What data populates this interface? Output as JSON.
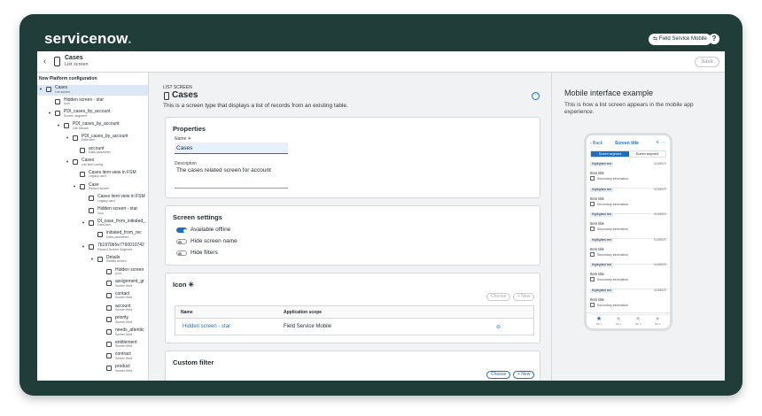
{
  "brand": {
    "name": "servicenow",
    "accent": "#81b5a1",
    "frame_color": "#213d3a",
    "link_color": "#1f6fbf"
  },
  "topbar": {
    "app_badge": "Field Service Mobile",
    "help_icon": "?"
  },
  "header": {
    "back": "‹",
    "title": "Cases",
    "subtitle": "List screen",
    "save": "Save"
  },
  "tree": {
    "heading": "Now Platform configuration",
    "nodes": [
      {
        "label": "Cases",
        "sub": "List screen",
        "caret": "▼",
        "selected": true
      },
      {
        "label": "Hidden screen - star",
        "sub": "Icon",
        "caret": ""
      },
      {
        "label": "PDI_cases_by_account",
        "sub": "Screen segment",
        "caret": "▼"
      },
      {
        "label": "PDI_cases_by_account",
        "sub": "List Stream",
        "caret": "▼"
      },
      {
        "label": "PDI_cases_by_account",
        "sub": "Data item",
        "caret": "▼"
      },
      {
        "label": "account",
        "sub": "Data parameter",
        "caret": ""
      },
      {
        "label": "Cases",
        "sub": "List item config",
        "caret": "▼"
      },
      {
        "label": "Cases item view in FSM",
        "sub": "Legacy card",
        "caret": ""
      },
      {
        "label": "Case",
        "sub": "Record screen",
        "caret": "▼"
      },
      {
        "label": "Cases item view in FSM",
        "sub": "Legacy card",
        "caret": ""
      },
      {
        "label": "Hidden screen - star",
        "sub": "Icon",
        "caret": ""
      },
      {
        "label": "DI_case_from_initiated_",
        "sub": "Data item",
        "caret": "▼"
      },
      {
        "label": "initiated_from_rec",
        "sub": "Data parameter",
        "caret": ""
      },
      {
        "label": "7b1970b5e7760010742",
        "sub": "Record Screen Segment",
        "caret": "▼"
      },
      {
        "label": "Details",
        "sub": "Details screen",
        "caret": "▼"
      },
      {
        "label": "Hidden screen",
        "sub": "Icon",
        "caret": ""
      },
      {
        "label": "assignment_gr",
        "sub": "Screen field",
        "caret": ""
      },
      {
        "label": "contact",
        "sub": "Screen field",
        "caret": ""
      },
      {
        "label": "account",
        "sub": "Screen field",
        "caret": ""
      },
      {
        "label": "priority",
        "sub": "Screen field",
        "caret": ""
      },
      {
        "label": "needs_attentic",
        "sub": "Screen field",
        "caret": ""
      },
      {
        "label": "entitlement",
        "sub": "Screen field",
        "caret": ""
      },
      {
        "label": "contract",
        "sub": "Screen field",
        "caret": ""
      },
      {
        "label": "product",
        "sub": "Screen field",
        "caret": ""
      }
    ]
  },
  "main": {
    "kicker": "LIST SCREEN",
    "title": "Cases",
    "description": "This is a screen type that displays a list of records from an existing table.",
    "more": "···",
    "properties": {
      "title": "Properties",
      "name_label": "Name ✳",
      "name_value": "Cases",
      "desc_label": "Description",
      "desc_value": "The cases related screen for account"
    },
    "screen_settings": {
      "title": "Screen settings",
      "toggles": [
        {
          "label": "Available offline",
          "on": true
        },
        {
          "label": "Hide screen name",
          "on": false
        },
        {
          "label": "Hide filters",
          "on": false
        }
      ]
    },
    "icon": {
      "title": "Icon ✳",
      "choose": "Choose",
      "new": "+ New",
      "col_name": "Name",
      "col_scope": "Application scope",
      "row_name": "Hidden screen - star",
      "row_scope": "Field Service Mobile",
      "remove": "⊖"
    },
    "custom_filter": {
      "title": "Custom filter",
      "choose": "Choose",
      "new": "+ New"
    }
  },
  "preview": {
    "title": "Mobile interface example",
    "description": "This is how a list screen appears in the mobile app experience.",
    "phone": {
      "back": "‹ Back",
      "title": "Screen title",
      "icons": "⚟ ···",
      "segments": [
        "Screen segment",
        "Screen segment"
      ],
      "items": [
        {
          "highlight": "Highlighted text",
          "number": "NUMBER",
          "title": "Item title",
          "secondary": "Secondary information"
        },
        {
          "highlight": "Highlighted text",
          "number": "NUMBER",
          "title": "Item title",
          "secondary": "Secondary information"
        },
        {
          "highlight": "Highlighted text",
          "number": "NUMBER",
          "title": "Item title",
          "secondary": "Secondary information"
        },
        {
          "highlight": "Highlighted text",
          "number": "NUMBER",
          "title": "Item title",
          "secondary": "Secondary information"
        },
        {
          "highlight": "Highlighted text",
          "number": "NUMBER",
          "title": "Item title",
          "secondary": "Secondary information"
        },
        {
          "highlight": "Highlighted text",
          "number": "NUMBER",
          "title": "Item title",
          "secondary": "Secondary information"
        }
      ],
      "tabs": [
        "Tab 1",
        "Tab 2",
        "Tab 3",
        "Tab 4"
      ]
    }
  }
}
